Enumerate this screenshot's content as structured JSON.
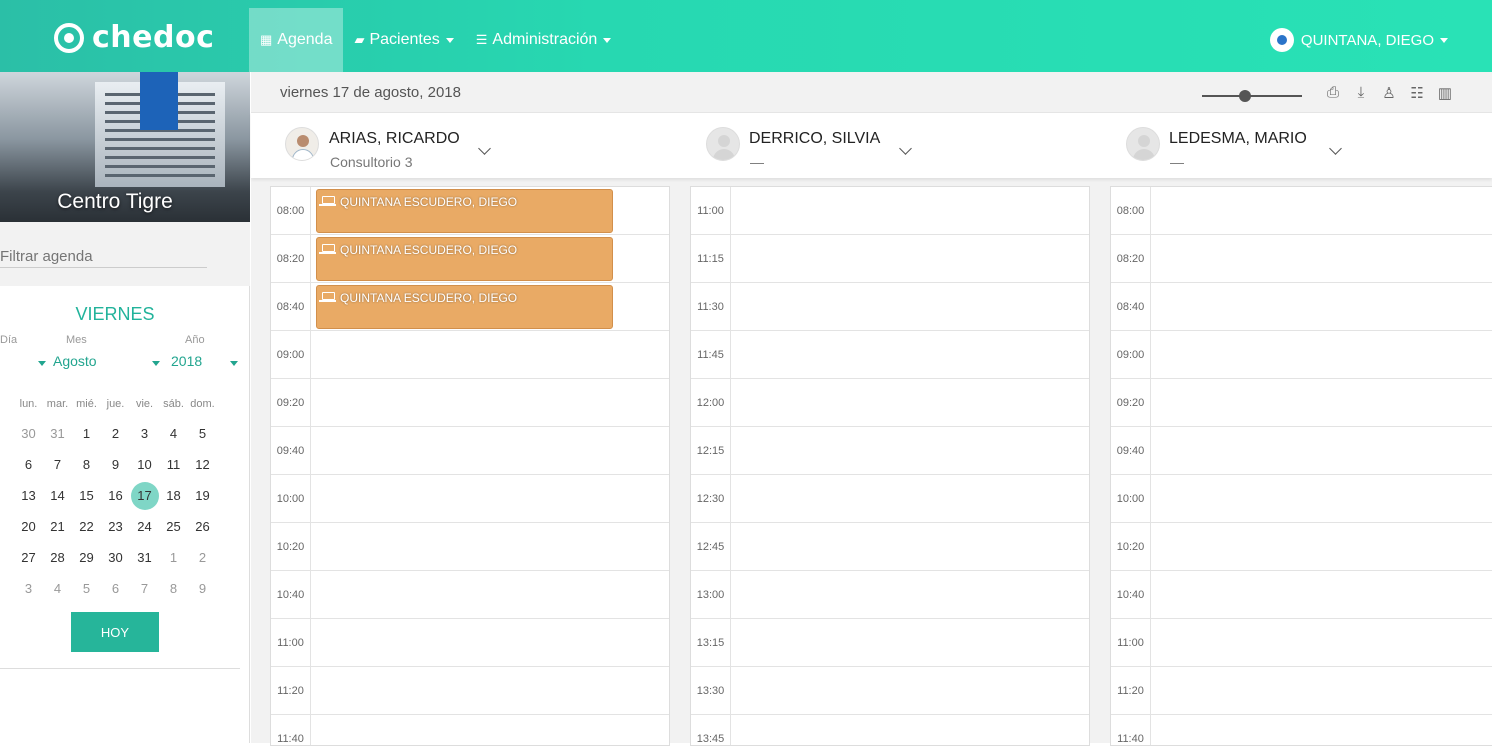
{
  "app": {
    "brand": "chedoc"
  },
  "nav": {
    "agenda": "Agenda",
    "pacientes": "Pacientes",
    "administracion": "Administración",
    "user": "QUINTANA, DIEGO"
  },
  "sidebar": {
    "center_name": "Centro Tigre",
    "filter_placeholder": "Filtrar agenda",
    "day_name": "VIERNES",
    "labels": {
      "dia": "Día",
      "mes": "Mes",
      "anio": "Año"
    },
    "month": "Agosto",
    "year": "2018",
    "weekdays": [
      "lun.",
      "mar.",
      "mié.",
      "jue.",
      "vie.",
      "sáb.",
      "dom."
    ],
    "weeks": [
      [
        "30",
        "31",
        "1",
        "2",
        "3",
        "4",
        "5"
      ],
      [
        "6",
        "7",
        "8",
        "9",
        "10",
        "11",
        "12"
      ],
      [
        "13",
        "14",
        "15",
        "16",
        "17",
        "18",
        "19"
      ],
      [
        "20",
        "21",
        "22",
        "23",
        "24",
        "25",
        "26"
      ],
      [
        "27",
        "28",
        "29",
        "30",
        "31",
        "1",
        "2"
      ],
      [
        "3",
        "4",
        "5",
        "6",
        "7",
        "8",
        "9"
      ]
    ],
    "selected_day": "17",
    "today_button": "HOY"
  },
  "main": {
    "date_text": "viernes 17 de agosto, 2018",
    "zoom_level": 0.43,
    "professionals": [
      {
        "name": "ARIAS, RICARDO",
        "sub": "Consultorio 3"
      },
      {
        "name": "DERRICO, SILVIA",
        "sub": "—"
      },
      {
        "name": "LEDESMA, MARIO",
        "sub": "—"
      }
    ],
    "columns": [
      {
        "times": [
          "08:00",
          "08:20",
          "08:40",
          "09:00",
          "09:20",
          "09:40",
          "10:00",
          "10:20",
          "10:40",
          "11:00",
          "11:20",
          "11:40"
        ],
        "appointments": [
          {
            "slot": 0,
            "patient": "QUINTANA ESCUDERO, DIEGO"
          },
          {
            "slot": 1,
            "patient": "QUINTANA ESCUDERO, DIEGO"
          },
          {
            "slot": 2,
            "patient": "QUINTANA ESCUDERO, DIEGO"
          }
        ]
      },
      {
        "times": [
          "11:00",
          "11:15",
          "11:30",
          "11:45",
          "12:00",
          "12:15",
          "12:30",
          "12:45",
          "13:00",
          "13:15",
          "13:30",
          "13:45"
        ],
        "appointments": []
      },
      {
        "times": [
          "08:00",
          "08:20",
          "08:40",
          "09:00",
          "09:20",
          "09:40",
          "10:00",
          "10:20",
          "10:40",
          "11:00",
          "11:20",
          "11:40"
        ],
        "appointments": []
      }
    ]
  },
  "colors": {
    "accent": "#27d8b1",
    "appointment": "#e9aa65",
    "hoy_button": "#26b59a"
  }
}
